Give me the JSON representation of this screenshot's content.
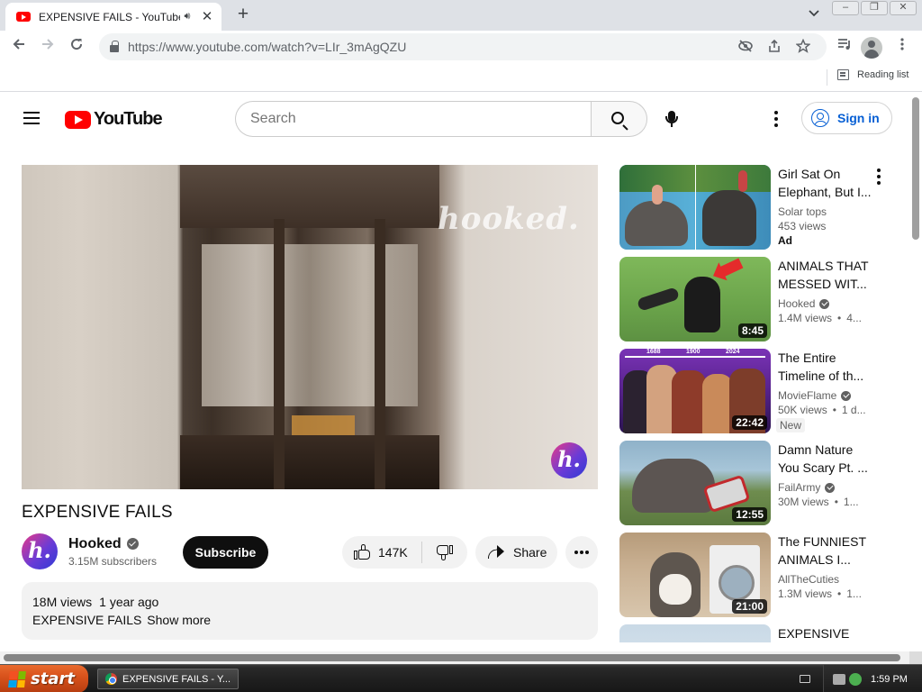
{
  "browser": {
    "tab": {
      "title": "EXPENSIVE FAILS - YouTube",
      "audio_icon": "speaker-icon",
      "close_glyph": "✕"
    },
    "new_tab_glyph": "+",
    "tab_search_glyph": "⌄",
    "window_buttons": [
      "–",
      "❐",
      "✕"
    ],
    "url": "https://www.youtube.com/watch?v=LIr_3mAgQZU",
    "reading_list_label": "Reading list"
  },
  "youtube": {
    "logo_text": "YouTube",
    "search_placeholder": "Search",
    "sign_in_label": "Sign in"
  },
  "video": {
    "title": "EXPENSIVE FAILS",
    "watermark": "hooked.",
    "badge_letter": "h.",
    "channel": {
      "name": "Hooked",
      "subscribers": "3.15M subscribers",
      "avatar_letter": "h."
    },
    "subscribe_label": "Subscribe",
    "likes": "147K",
    "share_label": "Share",
    "description": {
      "views": "18M views",
      "age": "1 year ago",
      "text": "EXPENSIVE FAILS",
      "show_more": "Show more"
    }
  },
  "related": [
    {
      "title": "Girl Sat On Elephant, But I...",
      "channel": "Solar tops",
      "verified": false,
      "views": "453 views",
      "age": "",
      "badge": "Ad",
      "duration": ""
    },
    {
      "title": "ANIMALS THAT MESSED WIT...",
      "channel": "Hooked",
      "verified": true,
      "views": "1.4M views",
      "age": "4...",
      "badge": "",
      "duration": "8:45"
    },
    {
      "title": "The Entire Timeline of th...",
      "channel": "MovieFlame",
      "verified": true,
      "views": "50K views",
      "age": "1 d...",
      "badge": "New",
      "duration": "22:42",
      "thumb_years": [
        "1688",
        "1900",
        "2024"
      ]
    },
    {
      "title": "Damn Nature You Scary Pt. ...",
      "channel": "FailArmy",
      "verified": true,
      "views": "30M views",
      "age": "1...",
      "badge": "",
      "duration": "12:55"
    },
    {
      "title": "The FUNNIEST ANIMALS I...",
      "channel": "AllTheCuties",
      "verified": false,
      "views": "1.3M views",
      "age": "1...",
      "badge": "",
      "duration": "21:00"
    },
    {
      "title": "EXPENSIVE",
      "channel": "",
      "verified": false,
      "views": "",
      "age": "",
      "badge": "",
      "duration": ""
    }
  ],
  "taskbar": {
    "start_label": "start",
    "task_label": "EXPENSIVE FAILS - Y...",
    "clock": "1:59 PM"
  },
  "colors": {
    "youtube_red": "#ff0000",
    "link_blue": "#065fd4",
    "xp_start_orange": "#d9531c"
  }
}
